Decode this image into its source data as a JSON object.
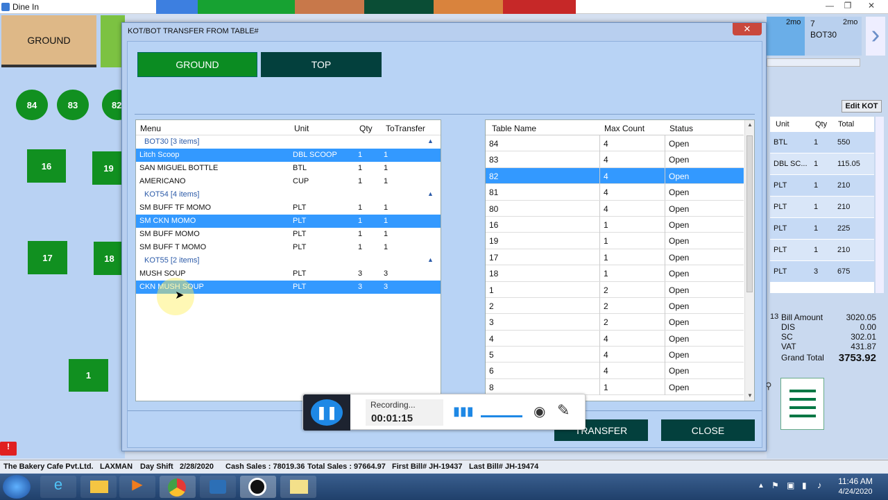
{
  "app": {
    "title": "Dine In"
  },
  "floor": {
    "active_tab": "GROUND",
    "tables": [
      "84",
      "83",
      "82",
      "16",
      "19",
      "17",
      "18",
      "1"
    ]
  },
  "right_panel": {
    "tab_number": "7",
    "tab_label": "BOT30",
    "time1": "2mo",
    "time2": "2mo",
    "edit_kot": "Edit KOT",
    "cols": [
      "Unit",
      "Qty",
      "Total"
    ],
    "rows": [
      [
        "BTL",
        "1",
        "550"
      ],
      [
        "DBL SC...",
        "1",
        "115.05"
      ],
      [
        "PLT",
        "1",
        "210"
      ],
      [
        "PLT",
        "1",
        "210"
      ],
      [
        "PLT",
        "1",
        "225"
      ],
      [
        "PLT",
        "1",
        "210"
      ],
      [
        "PLT",
        "3",
        "675"
      ]
    ],
    "bill_count": "13",
    "bill_amount_label": "Bill Amount",
    "bill_amount": "3020.05",
    "dis_label": "DIS",
    "dis": "0.00",
    "sc_label": "SC",
    "sc": "302.01",
    "vat_label": "VAT",
    "vat": "431.87",
    "grand_label": "Grand Total",
    "grand": "3753.92"
  },
  "dialog": {
    "title": "KOT/BOT TRANSFER FROM TABLE#",
    "close_x": "✕",
    "floors": [
      "GROUND",
      "TOP"
    ],
    "menu_cols": [
      "Menu",
      "Unit",
      "Qty",
      "ToTransfer"
    ],
    "groups": [
      {
        "label": "BOT30 [3 items]",
        "items": [
          [
            "Litch Scoop",
            "DBL SCOOP",
            "1",
            "1"
          ],
          [
            "SAN MIGUEL BOTTLE",
            "BTL",
            "1",
            "1"
          ],
          [
            "AMERICANO",
            "CUP",
            "1",
            "1"
          ]
        ]
      },
      {
        "label": "KOT54 [4 items]",
        "items": [
          [
            "SM BUFF TF MOMO",
            "PLT",
            "1",
            "1"
          ],
          [
            "SM CKN MOMO",
            "PLT",
            "1",
            "1"
          ],
          [
            "SM BUFF MOMO",
            "PLT",
            "1",
            "1"
          ],
          [
            "SM BUFF T MOMO",
            "PLT",
            "1",
            "1"
          ]
        ]
      },
      {
        "label": "KOT55 [2 items]",
        "items": [
          [
            "MUSH SOUP",
            "PLT",
            "3",
            "3"
          ],
          [
            "CKN MUSH SOUP",
            "PLT",
            "3",
            "3"
          ]
        ]
      }
    ],
    "table_cols": [
      "Table Name",
      "Max Count",
      "Status"
    ],
    "tables": [
      [
        "84",
        "4",
        "Open"
      ],
      [
        "83",
        "4",
        "Open"
      ],
      [
        "82",
        "4",
        "Open"
      ],
      [
        "81",
        "4",
        "Open"
      ],
      [
        "80",
        "4",
        "Open"
      ],
      [
        "16",
        "1",
        "Open"
      ],
      [
        "19",
        "1",
        "Open"
      ],
      [
        "17",
        "1",
        "Open"
      ],
      [
        "18",
        "1",
        "Open"
      ],
      [
        "1",
        "2",
        "Open"
      ],
      [
        "2",
        "2",
        "Open"
      ],
      [
        "3",
        "2",
        "Open"
      ],
      [
        "4",
        "4",
        "Open"
      ],
      [
        "5",
        "4",
        "Open"
      ],
      [
        "6",
        "4",
        "Open"
      ],
      [
        "8",
        "1",
        "Open"
      ]
    ],
    "transfer": "TRANSFER",
    "close": "CLOSE"
  },
  "recorder": {
    "status": "Recording...",
    "time": "00:01:15"
  },
  "status_bar": {
    "company": "The Bakery Cafe Pvt.Ltd.",
    "user": "LAXMAN",
    "shift": "Day Shift",
    "date": "2/28/2020",
    "cash": "Cash Sales : 78019.36",
    "total": "Total Sales : 97664.97",
    "first": "First Bill# JH-19437",
    "last": "Last Bill# JH-19474"
  },
  "taskbar": {
    "time": "11:46 AM",
    "date": "4/24/2020"
  }
}
